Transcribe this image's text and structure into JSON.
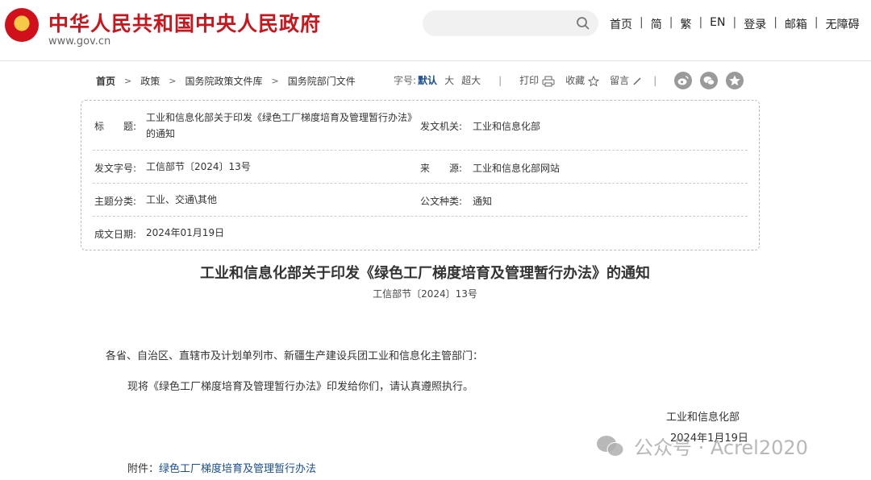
{
  "header": {
    "site_title": "中华人民共和国中央人民政府",
    "site_domain": "www.gov.cn",
    "search_placeholder": "",
    "nav": [
      "首页",
      "简",
      "繁",
      "EN",
      "登录",
      "邮箱",
      "无障碍"
    ]
  },
  "breadcrumb": [
    "首页",
    "政策",
    "国务院政策文件库",
    "国务院部门文件"
  ],
  "toolbar": {
    "font_label": "字号:",
    "font_default": "默认",
    "font_large": "大",
    "font_xlarge": "超大",
    "print": "打印",
    "favorite": "收藏",
    "comment": "留言"
  },
  "info": {
    "title_label": "标　　题:",
    "title_value": "工业和信息化部关于印发《绿色工厂梯度培育及管理暂行办法》的通知",
    "issuer_label": "发文机关:",
    "issuer_value": "工业和信息化部",
    "docno_label": "发文字号:",
    "docno_value": "工信部节〔2024〕13号",
    "source_label": "来　　源:",
    "source_value": "工业和信息化部网站",
    "category_label": "主题分类:",
    "category_value": "工业、交通\\其他",
    "type_label": "公文种类:",
    "type_value": "通知",
    "date_label": "成文日期:",
    "date_value": "2024年01月19日"
  },
  "article": {
    "title": "工业和信息化部关于印发《绿色工厂梯度培育及管理暂行办法》的通知",
    "docno": "工信部节〔2024〕13号",
    "salutation": "各省、自治区、直辖市及计划单列市、新疆生产建设兵团工业和信息化主管部门：",
    "body": "现将《绿色工厂梯度培育及管理暂行办法》印发给你们，请认真遵照执行。",
    "signer": "工业和信息化部",
    "date": "2024年1月19日",
    "attachment_label": "附件：",
    "attachment_link": "绿色工厂梯度培育及管理暂行办法"
  },
  "watermark": "公众号 · Acrel2020",
  "colors": {
    "brand_red": "#c8161d",
    "link_blue": "#1a4d8f"
  }
}
